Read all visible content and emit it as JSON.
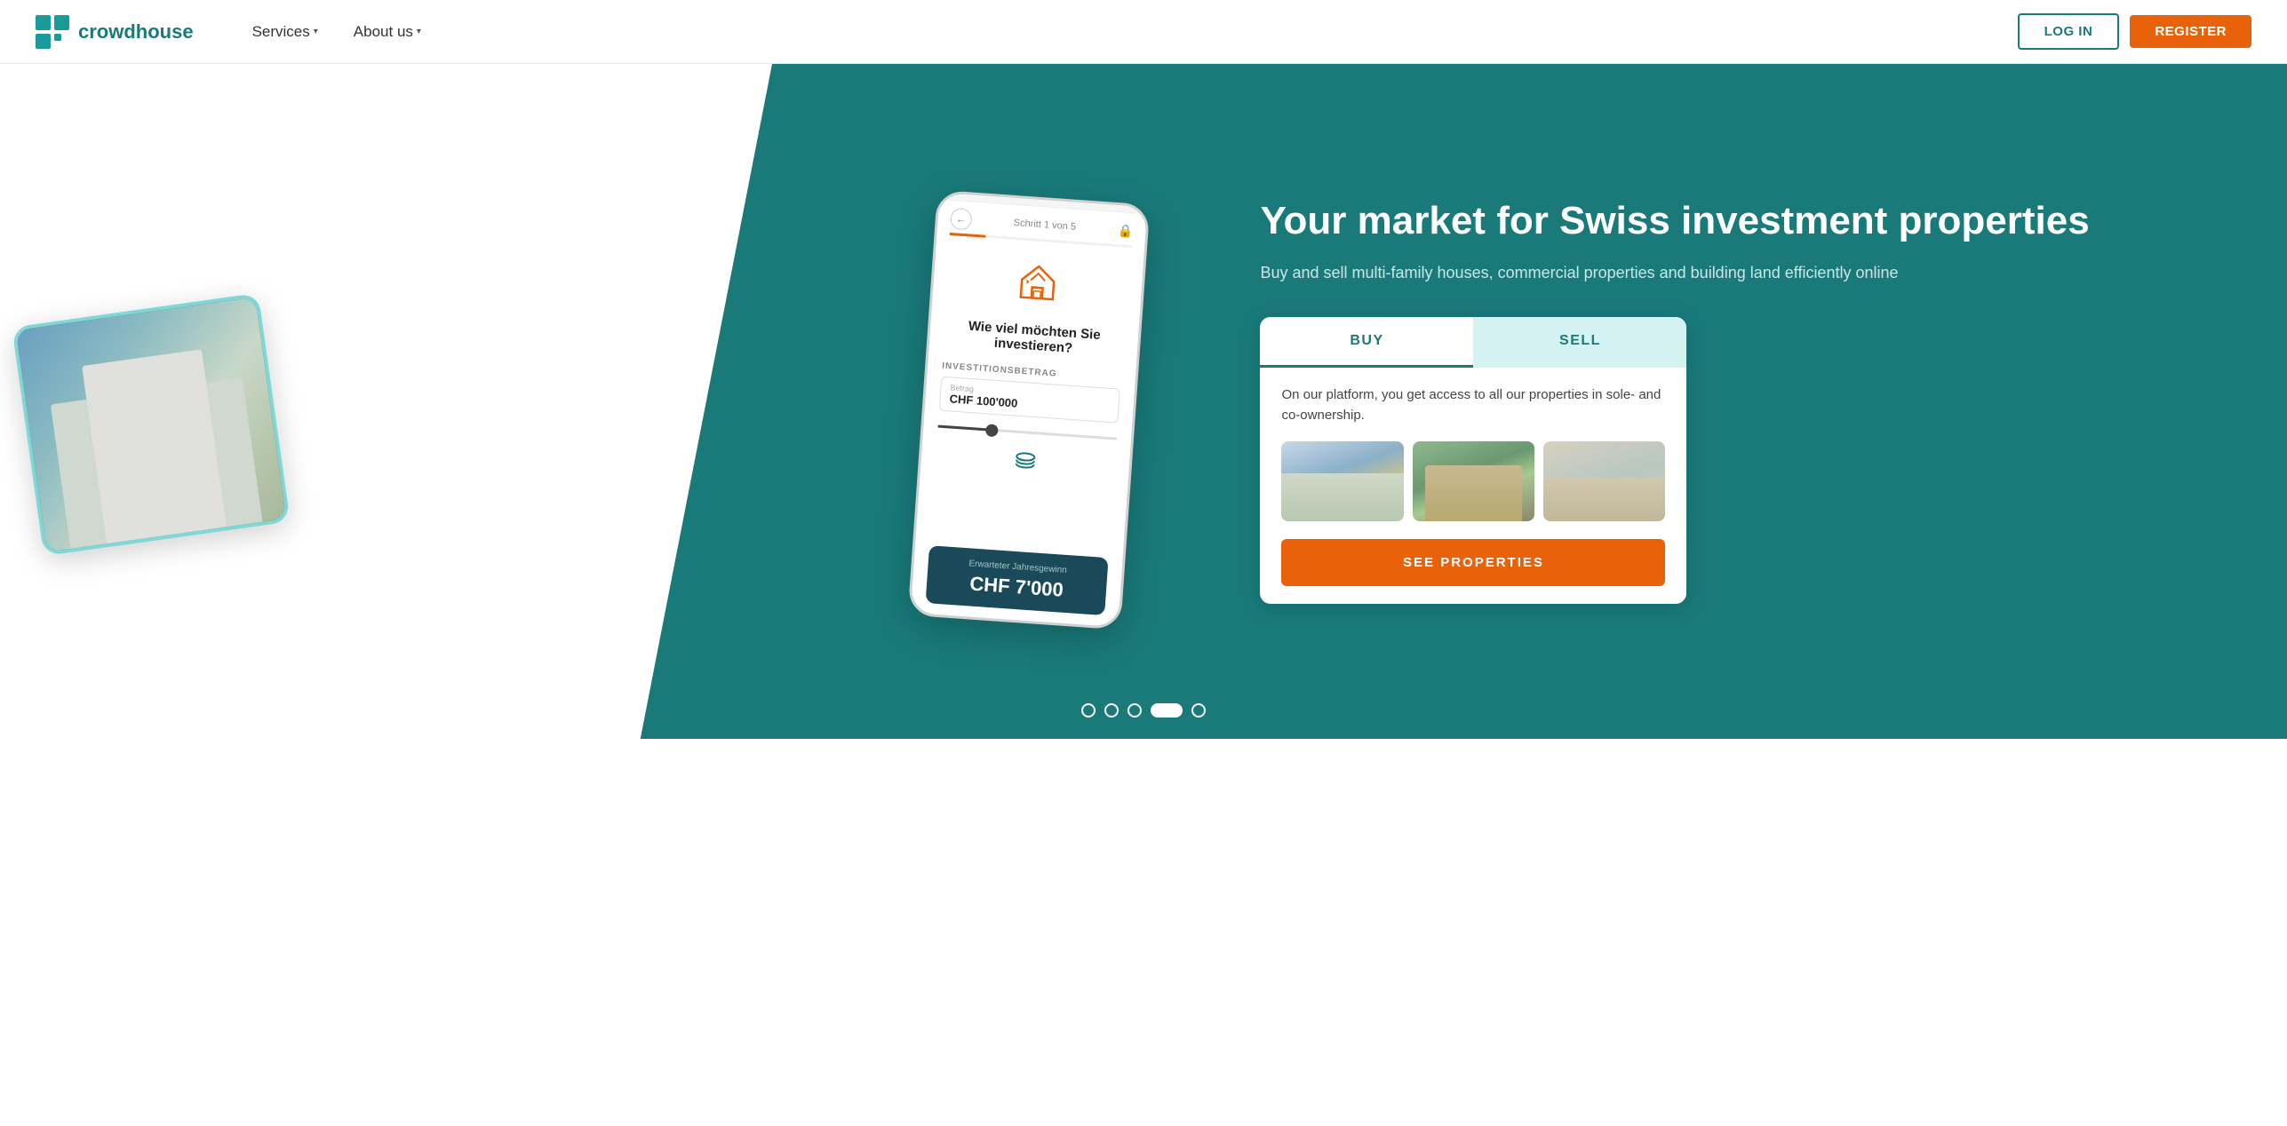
{
  "header": {
    "logo_text": "crowdhouse",
    "nav": [
      {
        "label": "Services",
        "has_dropdown": true
      },
      {
        "label": "About us",
        "has_dropdown": true
      }
    ],
    "login_label": "LOG IN",
    "register_label": "REGISTER"
  },
  "hero": {
    "title": "Your market for Swiss investment properties",
    "subtitle": "Buy and sell multi-family houses, commercial properties and building land efficiently online",
    "phone": {
      "step_label": "Schritt 1 von 5",
      "question": "Wie viel möchten Sie investieren?",
      "field_label": "INVESTITIONSBETRAG",
      "field_sublabel": "Betrag",
      "field_value": "CHF 100'000",
      "result_label": "Erwarteter Jahresgewinn",
      "result_value": "CHF 7'000"
    }
  },
  "buy_sell_card": {
    "tab_buy": "BUY",
    "tab_sell": "SELL",
    "description": "On our platform, you get access to all our properties in sole- and co-ownership.",
    "cta_label": "SEE PROPERTIES"
  },
  "pagination": {
    "dots": [
      "dot1",
      "dot2",
      "dot3",
      "dot-active",
      "dot5"
    ]
  }
}
